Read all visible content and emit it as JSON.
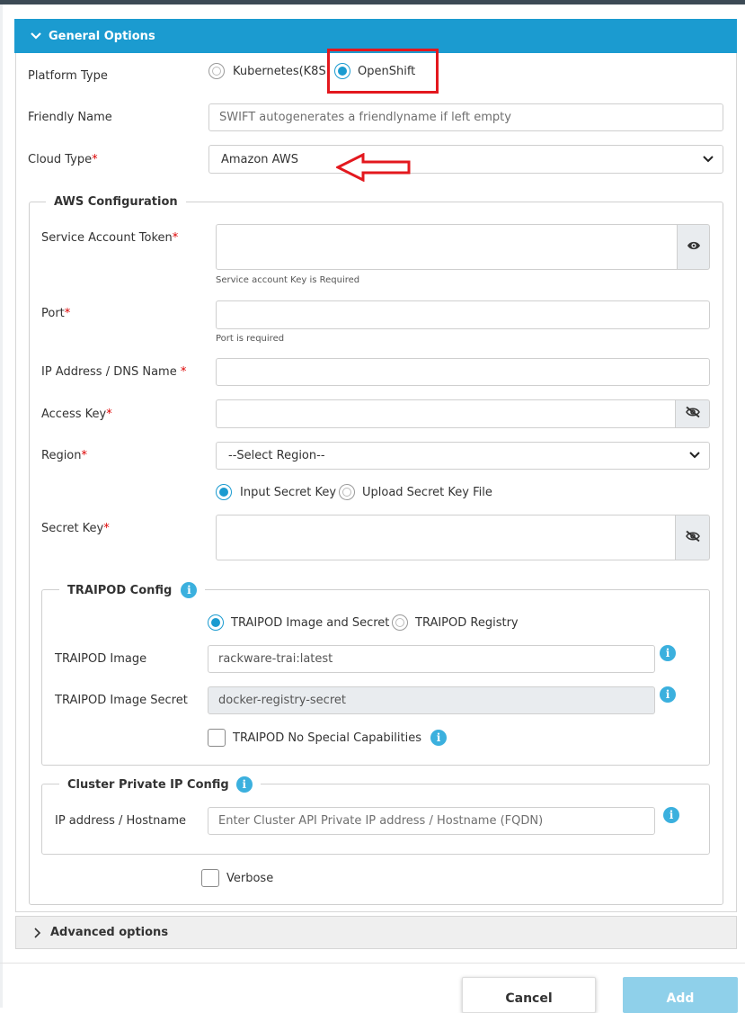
{
  "general": {
    "title": "General Options"
  },
  "platform": {
    "label": "Platform Type",
    "options": [
      "Kubernetes(K8S)",
      "OpenShift"
    ],
    "selected": "OpenShift"
  },
  "friendly_name": {
    "label": "Friendly Name",
    "placeholder": "SWIFT autogenerates a friendlyname if left empty"
  },
  "cloud_type": {
    "label": "Cloud Type",
    "required": "*",
    "value": "Amazon AWS"
  },
  "aws": {
    "title": "AWS Configuration",
    "service_account_token": {
      "label": "Service Account Token",
      "required": "*",
      "hint": "Service account Key is Required"
    },
    "port": {
      "label": "Port",
      "required": "*",
      "hint": "Port is required"
    },
    "ip_dns": {
      "label": "IP Address / DNS Name ",
      "required": "*"
    },
    "access_key": {
      "label": "Access Key",
      "required": "*"
    },
    "region": {
      "label": "Region",
      "required": "*",
      "value": "--Select Region--"
    },
    "secret_mode": {
      "options": [
        "Input Secret Key",
        "Upload Secret Key File"
      ],
      "selected": "Input Secret Key"
    },
    "secret_key": {
      "label": "Secret Key",
      "required": "*"
    }
  },
  "traipod": {
    "title": "TRAIPOD Config",
    "options": [
      "TRAIPOD Image and Secret",
      "TRAIPOD Registry"
    ],
    "selected": "TRAIPOD Image and Secret",
    "image": {
      "label": "TRAIPOD Image",
      "value": "rackware-trai:latest"
    },
    "image_secret": {
      "label": "TRAIPOD Image Secret",
      "value": "docker-registry-secret"
    },
    "no_special": {
      "label": "TRAIPOD No Special Capabilities",
      "checked": false
    }
  },
  "cluster": {
    "title": "Cluster Private IP Config",
    "ip_label": "IP address / Hostname",
    "ip_placeholder": "Enter Cluster API Private IP address / Hostname (FQDN)"
  },
  "verbose": {
    "label": "Verbose",
    "checked": false
  },
  "advanced": {
    "title": "Advanced options"
  },
  "buttons": {
    "cancel": "Cancel",
    "add": "Add"
  },
  "info_icon_glyph": "i",
  "colors": {
    "accent": "#1b9bd0",
    "annotation": "#e3181e",
    "required": "#dd0000"
  }
}
